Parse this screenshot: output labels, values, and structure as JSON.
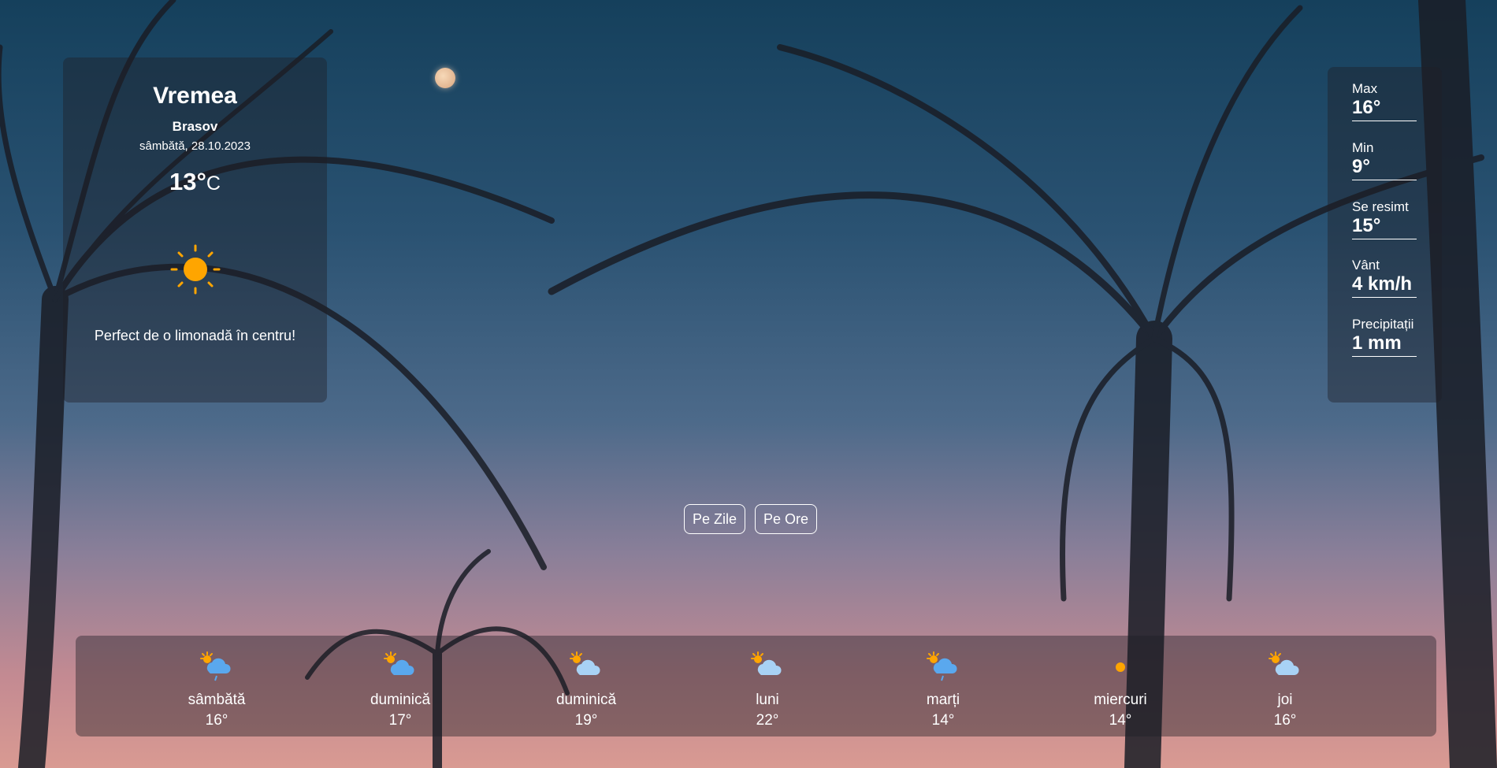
{
  "current": {
    "title": "Vremea",
    "city": "Brasov",
    "date": "sâmbătă, 28.10.2023",
    "temperature": "13°",
    "unit": "C",
    "icon": "sun-icon",
    "message": "Perfect de o limonadă în centru!"
  },
  "details": [
    {
      "label": "Max",
      "value": "16°"
    },
    {
      "label": "Min",
      "value": "9°"
    },
    {
      "label": "Se resimt",
      "value": "15°"
    },
    {
      "label": "Vânt",
      "value": "4 km/h"
    },
    {
      "label": "Precipitații",
      "value": "1 mm"
    }
  ],
  "toggle": {
    "days_label": "Pe Zile",
    "hours_label": "Pe Ore"
  },
  "forecast": [
    {
      "day": "sâmbătă",
      "temp": "16°",
      "icon": "sun-cloud-rain-icon"
    },
    {
      "day": "duminică",
      "temp": "17°",
      "icon": "sun-cloud-icon"
    },
    {
      "day": "duminică",
      "temp": "19°",
      "icon": "sun-cloud-icon"
    },
    {
      "day": "luni",
      "temp": "22°",
      "icon": "sun-cloud-icon"
    },
    {
      "day": "marți",
      "temp": "14°",
      "icon": "sun-cloud-rain-icon"
    },
    {
      "day": "miercuri",
      "temp": "14°",
      "icon": "sun-icon"
    },
    {
      "day": "joi",
      "temp": "16°",
      "icon": "sun-cloud-icon"
    }
  ],
  "colors": {
    "sun": "#ffa500",
    "cloud": "#8ec5f0",
    "panel": "rgba(30,30,38,0.42)"
  }
}
